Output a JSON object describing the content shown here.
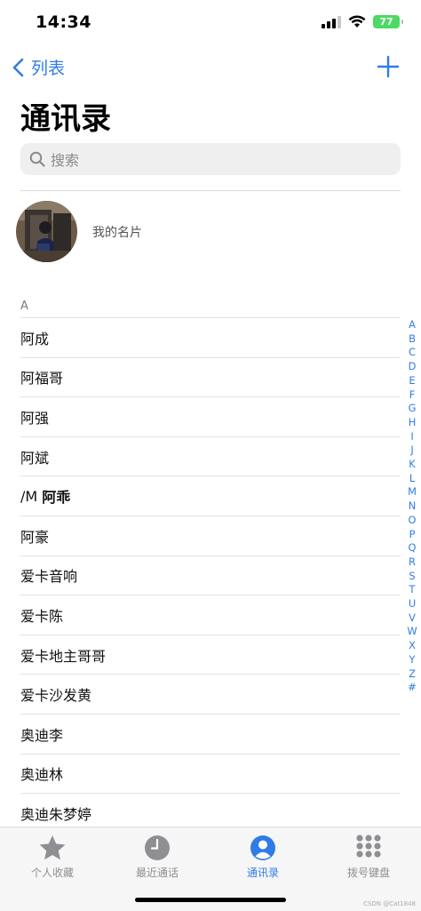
{
  "status_bar": {
    "time": "14:34",
    "battery": "77"
  },
  "nav": {
    "back_label": "列表"
  },
  "page": {
    "title": "通讯录"
  },
  "search": {
    "placeholder": "搜索"
  },
  "my_card": {
    "label": "我的名片"
  },
  "section": {
    "letter": "A"
  },
  "contacts": [
    {
      "name": "阿成"
    },
    {
      "name": "阿福哥"
    },
    {
      "name": "阿强"
    },
    {
      "name": "阿斌"
    },
    {
      "prefix": "/M",
      "name": "阿乖"
    },
    {
      "name": "阿豪"
    },
    {
      "name": "爱卡音响"
    },
    {
      "name": "爱卡陈"
    },
    {
      "name": "爱卡地主哥哥"
    },
    {
      "name": "爱卡沙发黄"
    },
    {
      "name": "奥迪李"
    },
    {
      "name": "奥迪林"
    },
    {
      "name": "奥迪朱梦婷"
    }
  ],
  "alpha_index": [
    "A",
    "B",
    "C",
    "D",
    "E",
    "F",
    "G",
    "H",
    "I",
    "J",
    "K",
    "L",
    "M",
    "N",
    "O",
    "P",
    "Q",
    "R",
    "S",
    "T",
    "U",
    "V",
    "W",
    "X",
    "Y",
    "Z",
    "#"
  ],
  "tabs": [
    {
      "label": "个人收藏",
      "icon": "star-icon"
    },
    {
      "label": "最近通话",
      "icon": "clock-icon"
    },
    {
      "label": "通讯录",
      "icon": "person-icon",
      "active": true
    },
    {
      "label": "拨号键盘",
      "icon": "keypad-icon"
    }
  ],
  "watermark": "CSDN @Cat1848",
  "colors": {
    "accent": "#2f7ce8",
    "battery": "#4cd964",
    "search_bg": "#efeff0"
  }
}
